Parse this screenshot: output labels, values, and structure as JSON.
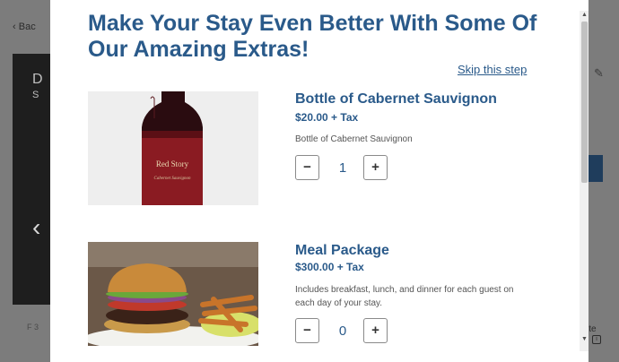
{
  "background": {
    "back_label": "Bac",
    "photo_text_1": "D",
    "photo_text_2": "S",
    "bottom_left_text": "F\n3",
    "right_text": "ite"
  },
  "modal": {
    "title": "Make Your Stay Even Better With Some Of Our Amazing Extras!",
    "skip_label": "Skip this step",
    "products": [
      {
        "name": "Bottle of Cabernet Sauvignon",
        "price": "$20.00 + Tax",
        "description": "Bottle of Cabernet Sauvignon",
        "quantity": "1",
        "label_text": "Red Story",
        "label_sub": "Cabernet Sauvignon"
      },
      {
        "name": "Meal Package",
        "price": "$300.00 + Tax",
        "description": "Includes breakfast, lunch, and dinner for each guest on each day of your stay.",
        "quantity": "0"
      }
    ],
    "minus_label": "−",
    "plus_label": "+"
  },
  "colors": {
    "accent": "#2a5a8a",
    "overlay": "#7f7f7f"
  }
}
